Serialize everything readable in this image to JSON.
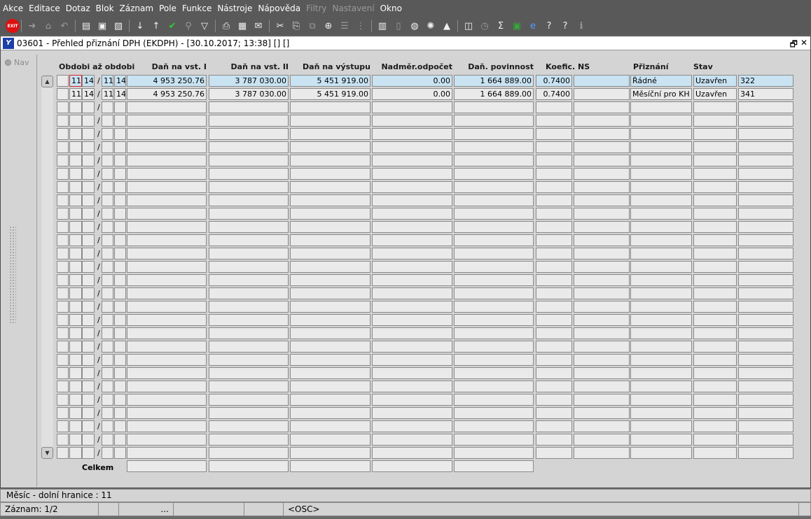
{
  "menu": [
    "Akce",
    "Editace",
    "Dotaz",
    "Blok",
    "Záznam",
    "Pole",
    "Funkce",
    "Nástroje",
    "Nápověda",
    "Filtry",
    "Nastavení",
    "Okno"
  ],
  "menu_disabled": [
    "Filtry",
    "Nastavení"
  ],
  "exit_label": "EXIT",
  "window": {
    "title": "03601 - Přehled přiznání DPH (EKDPH) - [30.10.2017; 13:38] [] []",
    "logo": "Y",
    "restore_glyph": "🗗",
    "close_glyph": "✕"
  },
  "nav": {
    "label": "Nav"
  },
  "headers": {
    "period": "Obdobi až obdobi",
    "vat_in_1": "Daň na vst. I",
    "vat_in_2": "Daň na vst. II",
    "vat_out": "Daň na výstupu",
    "excess": "Nadměr.odpočet",
    "liability": "Daň. povinnost",
    "coef": "Koefic. NS",
    "return": "Přiznání",
    "state": "Stav"
  },
  "rows": [
    {
      "m1": "11",
      "y1": "14",
      "m2": "11",
      "y2": "14",
      "vat_in_1": "4 953 250.76",
      "vat_in_2": "3 787 030.00",
      "vat_out": "5 451 919.00",
      "excess": "0.00",
      "liability": "1 664 889.00",
      "coef": "0.7400",
      "ns": "",
      "return": "Řádné",
      "state": "Uzavřen",
      "num": "322"
    },
    {
      "m1": "11",
      "y1": "14",
      "m2": "11",
      "y2": "14",
      "vat_in_1": "4 953 250.76",
      "vat_in_2": "3 787 030.00",
      "vat_out": "5 451 919.00",
      "excess": "0.00",
      "liability": "1 664 889.00",
      "coef": "0.7400",
      "ns": "",
      "return": "Měsíční pro KH",
      "state": "Uzavřen",
      "num": "341"
    }
  ],
  "total_label": "Celkem",
  "status": {
    "hint": "Měsíc - dolní hranice : 11",
    "record": "Záznam: 1/2",
    "ellipsis": "...",
    "mode": "<OSC>"
  },
  "colors": {
    "selected_row": "#c9e3f3",
    "cell": "#eaeaea",
    "focus_border": "#d62020"
  }
}
